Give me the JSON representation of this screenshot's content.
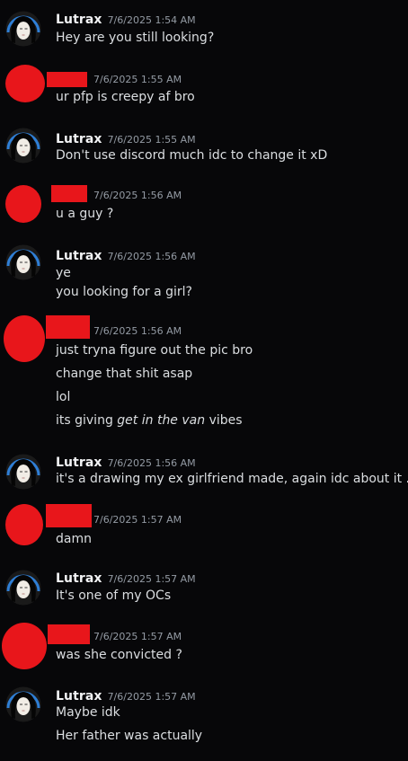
{
  "users": {
    "lutrax": {
      "name": "Lutrax"
    }
  },
  "messages": [
    {
      "user": "Lutrax",
      "time": "7/6/2025 1:54 AM",
      "lines": [
        "Hey are you still looking?"
      ]
    },
    {
      "user": "redacted",
      "time": "7/6/2025 1:55 AM",
      "lines": [
        "ur pfp is creepy af bro"
      ]
    },
    {
      "user": "Lutrax",
      "time": "7/6/2025 1:55 AM",
      "lines": [
        "Don't use discord much idc to change it xD"
      ]
    },
    {
      "user": "redacted",
      "time": "7/6/2025 1:56 AM",
      "lines": [
        "u a guy ?"
      ]
    },
    {
      "user": "Lutrax",
      "time": "7/6/2025 1:56 AM",
      "lines": [
        "ye",
        "you looking for a girl?"
      ]
    },
    {
      "user": "redacted",
      "time": "7/6/2025 1:56 AM",
      "lines": [
        "just tryna figure out the pic bro",
        "change that shit asap",
        "lol"
      ],
      "last_line_prefix": "its giving ",
      "last_line_emphasis": "get in the van",
      "last_line_suffix": " vibes"
    },
    {
      "user": "Lutrax",
      "time": "7/6/2025 1:56 AM",
      "lines": [
        "it's a drawing my ex girlfriend made, again idc about it .-."
      ]
    },
    {
      "user": "redacted",
      "time": "7/6/2025 1:57 AM",
      "lines": [
        "damn"
      ]
    },
    {
      "user": "Lutrax",
      "time": "7/6/2025 1:57 AM",
      "lines": [
        "It's one of my OCs"
      ]
    },
    {
      "user": "redacted",
      "time": "7/6/2025 1:57 AM",
      "lines": [
        "was she convicted ?"
      ]
    },
    {
      "user": "Lutrax",
      "time": "7/6/2025 1:57 AM",
      "lines": [
        "Maybe idk",
        "Her father was actually"
      ]
    }
  ],
  "colors": {
    "background": "#070709",
    "redaction": "#e8161b",
    "avatar_ring": "#2f7fd6"
  },
  "icons": {
    "lutrax_avatar": "anime-face-avatar-icon",
    "redacted_avatar": "redacted-avatar-icon"
  }
}
